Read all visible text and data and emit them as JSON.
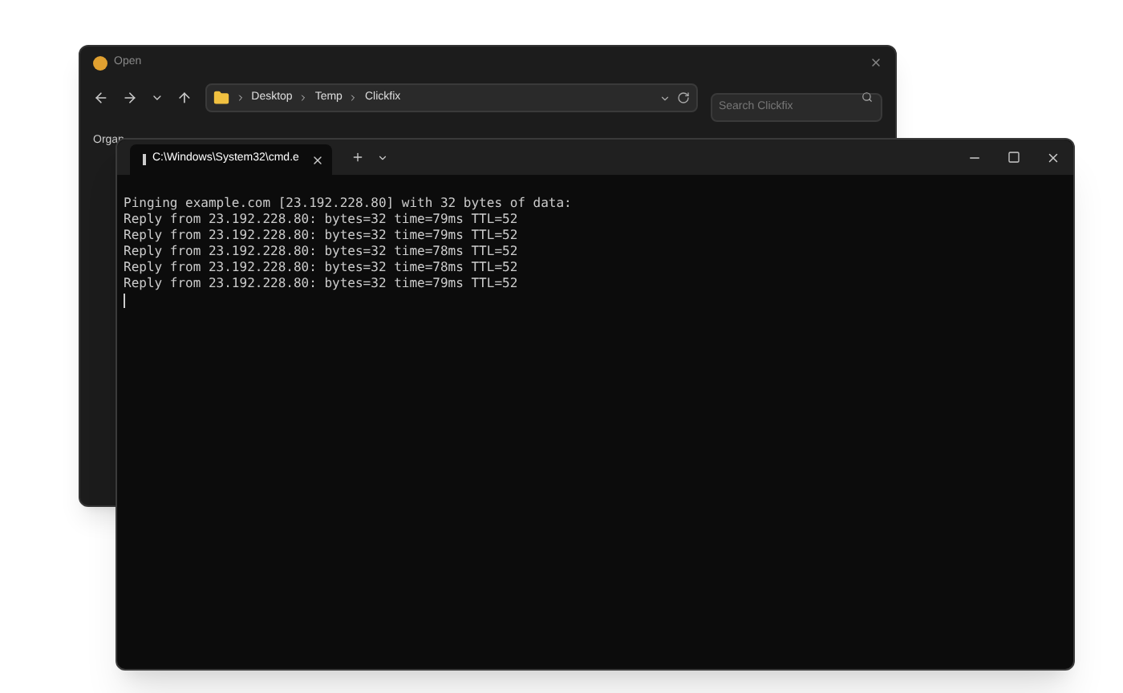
{
  "dialog": {
    "title": "Open",
    "breadcrumbs": [
      "Desktop",
      "Temp",
      "Clickfix"
    ],
    "search": {
      "placeholder": "Search Clickfix"
    },
    "toolbar_label": "Organ"
  },
  "terminal": {
    "tabs": [
      {
        "title": "C:\\Windows\\System32\\cmd.e",
        "selected": true
      }
    ],
    "lines": [
      "Pinging example.com [23.192.228.80] with 32 bytes of data:",
      "Reply from 23.192.228.80: bytes=32 time=79ms TTL=52",
      "Reply from 23.192.228.80: bytes=32 time=79ms TTL=52",
      "Reply from 23.192.228.80: bytes=32 time=78ms TTL=52",
      "Reply from 23.192.228.80: bytes=32 time=78ms TTL=52",
      "Reply from 23.192.228.80: bytes=32 time=79ms TTL=52"
    ]
  }
}
